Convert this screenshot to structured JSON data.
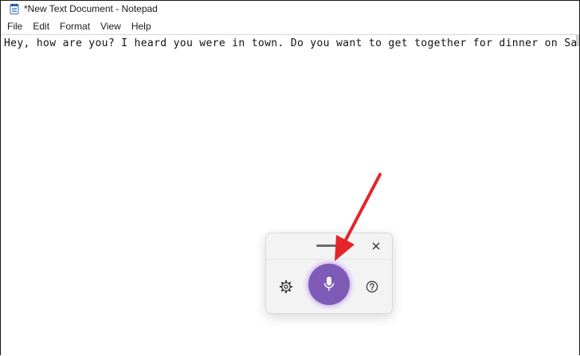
{
  "window": {
    "title": "*New Text Document - Notepad",
    "icon": "notepad-icon"
  },
  "menu": {
    "items": [
      {
        "label": "File"
      },
      {
        "label": "Edit"
      },
      {
        "label": "Format"
      },
      {
        "label": "View"
      },
      {
        "label": "Help"
      }
    ]
  },
  "editor": {
    "text": "Hey, how are you? I heard you were in town. Do you want to get together for dinner on Satu"
  },
  "voice_typing": {
    "icons": [
      "drag-handle",
      "close-icon",
      "settings-icon",
      "microphone-icon",
      "help-icon"
    ],
    "accent_color": "#7f5bb8"
  },
  "annotation": {
    "color": "#e4252a",
    "icon": "arrow-icon"
  }
}
